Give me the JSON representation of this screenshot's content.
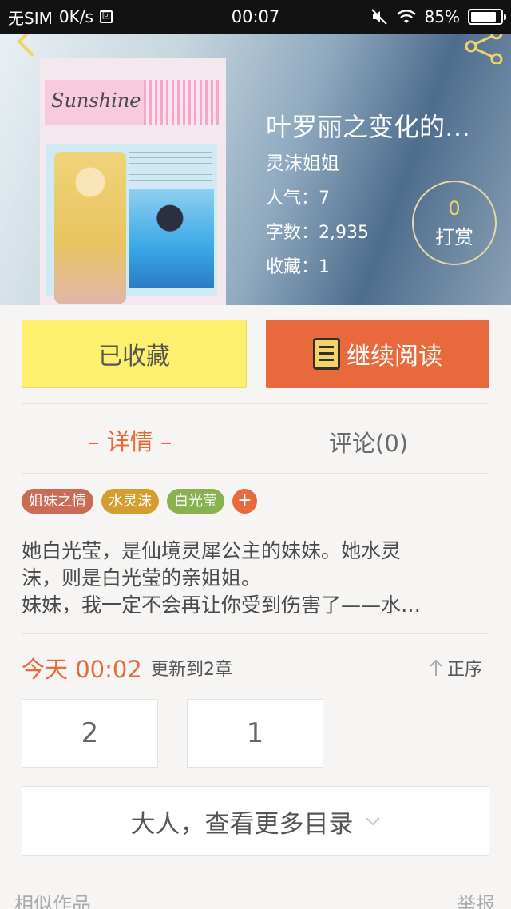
{
  "status_bar": {
    "carrier": "无SIM",
    "speed": "0K/s",
    "sim_icon_glyph": "回",
    "time": "00:07",
    "battery": "85%"
  },
  "book": {
    "cover_title": "Sunshine",
    "title": "叶罗丽之变化的…",
    "author": "灵沫姐姐",
    "popularity": "人气：7",
    "word_count": "字数：2,935",
    "favorites": "收藏：1"
  },
  "reward": {
    "count": "0",
    "label": "打赏"
  },
  "actions": {
    "collected": "已收藏",
    "continue_reading": "继续阅读"
  },
  "tabs": {
    "detail": "– 详情 –",
    "comments": "评论(0)"
  },
  "tags": [
    "姐妹之情",
    "水灵沫",
    "白光莹"
  ],
  "tag_add": "+",
  "synopsis": [
    "她白光莹，是仙境灵犀公主的妹妹。她水灵",
    "沫，则是白光莹的亲姐姐。",
    "妹妹，我一定不会再让你受到伤害了——水…"
  ],
  "update": {
    "time": "今天 00:02",
    "text": "更新到2章",
    "order": "正序"
  },
  "chapters": [
    "2",
    "1"
  ],
  "more_toc": "大人，查看更多目录",
  "footer": {
    "similar": "相似作品",
    "report": "举报"
  },
  "colors": {
    "accent": "#e8693b",
    "collected_bg": "#fdf06e",
    "reward_gold": "#f2d26a"
  }
}
